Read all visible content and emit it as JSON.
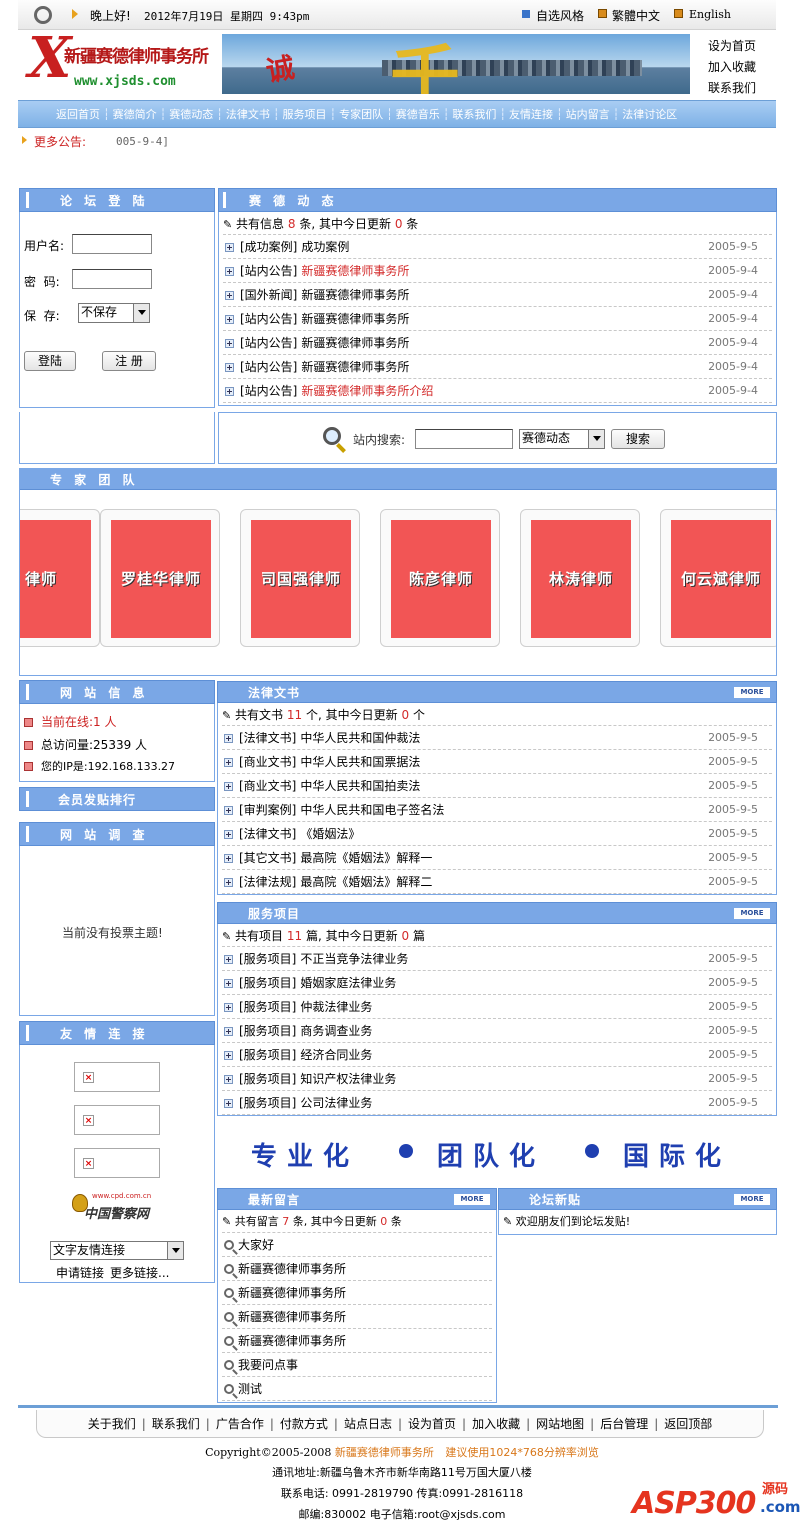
{
  "topbar": {
    "greeting": "晚上好!",
    "datetime": "2012年7月19日 星期四 9:43pm",
    "style_link": "自选风格",
    "trad_link": "繁體中文",
    "english_link": "English"
  },
  "header": {
    "logo_title": "新疆赛德律师事务所",
    "logo_letter": "X",
    "logo_url": "www.xjsds.com",
    "banner_text": "诚",
    "side_links": [
      "设为首页",
      "加入收藏",
      "联系我们"
    ]
  },
  "nav": {
    "items": [
      "返回首页",
      "赛德简介",
      "赛德动态",
      "法律文书",
      "服务项目",
      "专家团队",
      "赛德音乐",
      "联系我们",
      "友情连接",
      "站内留言",
      "法律讨论区"
    ]
  },
  "notice": {
    "label": "更多公告:",
    "text": "005-9-4]"
  },
  "login": {
    "title": "论 坛 登 陆",
    "username_label": "用户名:",
    "password_label": "密  码:",
    "save_label": "保  存:",
    "save_value": "不保存",
    "login_button": "登陆",
    "register_button": "注 册"
  },
  "news": {
    "title": "赛 德 动 态",
    "summary_pre": "共有信息",
    "summary_count": "8",
    "summary_mid": "条, 其中今日更新",
    "summary_today": "0",
    "summary_post": "条",
    "items": [
      {
        "cat": "[成功案例]",
        "title": "成功案例",
        "date": "2005-9-5",
        "highlight": false
      },
      {
        "cat": "[站内公告]",
        "title": "新疆赛德律师事务所",
        "date": "2005-9-4",
        "highlight": true
      },
      {
        "cat": "[国外新闻]",
        "title": "新疆赛德律师事务所",
        "date": "2005-9-4",
        "highlight": false
      },
      {
        "cat": "[站内公告]",
        "title": "新疆赛德律师事务所",
        "date": "2005-9-4",
        "highlight": false
      },
      {
        "cat": "[站内公告]",
        "title": "新疆赛德律师事务所",
        "date": "2005-9-4",
        "highlight": false
      },
      {
        "cat": "[站内公告]",
        "title": "新疆赛德律师事务所",
        "date": "2005-9-4",
        "highlight": false
      },
      {
        "cat": "[站内公告]",
        "title": "新疆赛德律师事务所介绍",
        "date": "2005-9-4",
        "highlight": true
      }
    ]
  },
  "search": {
    "label": "站内搜索:",
    "scope_value": "赛德动态",
    "button": "搜索"
  },
  "experts": {
    "title": "专 家 团 队",
    "lawyers": [
      "律师",
      "罗桂华律师",
      "司国强律师",
      "陈彦律师",
      "林涛律师",
      "何云斌律师"
    ]
  },
  "site_info": {
    "title": "网 站 信 息",
    "online": "当前在线:1 人",
    "visits": "总访问量:25339 人",
    "ip": "您的IP是:192.168.133.27"
  },
  "ranking": {
    "title": "会员发贴排行"
  },
  "survey": {
    "title": "网 站 调 查",
    "empty_text": "当前没有投票主题!"
  },
  "friends": {
    "title": "友 情 连 接",
    "police_logo_text": "中国警察网",
    "police_logo_url": "www.cpd.com.cn",
    "select_value": "文字友情连接",
    "apply_link": "申请链接",
    "more_link": "更多链接..."
  },
  "docs": {
    "title": "法律文书",
    "more": "MORE",
    "summary_pre": "共有文书",
    "summary_count": "11",
    "summary_mid": "个, 其中今日更新",
    "summary_today": "0",
    "summary_post": "个",
    "items": [
      {
        "cat": "[法律文书]",
        "title": "中华人民共和国仲裁法",
        "date": "2005-9-5"
      },
      {
        "cat": "[商业文书]",
        "title": "中华人民共和国票据法",
        "date": "2005-9-5"
      },
      {
        "cat": "[商业文书]",
        "title": "中华人民共和国拍卖法",
        "date": "2005-9-5"
      },
      {
        "cat": "[审判案例]",
        "title": "中华人民共和国电子签名法",
        "date": "2005-9-5"
      },
      {
        "cat": "[法律文书]",
        "title": "《婚姻法》",
        "date": "2005-9-5"
      },
      {
        "cat": "[其它文书]",
        "title": "最高院《婚姻法》解释一",
        "date": "2005-9-5"
      },
      {
        "cat": "[法律法规]",
        "title": "最高院《婚姻法》解释二",
        "date": "2005-9-5"
      }
    ]
  },
  "services": {
    "title": "服务项目",
    "more": "MORE",
    "summary_pre": "共有项目",
    "summary_count": "11",
    "summary_mid": "篇, 其中今日更新",
    "summary_today": "0",
    "summary_post": "篇",
    "items": [
      {
        "cat": "[服务项目]",
        "title": "不正当竞争法律业务",
        "date": "2005-9-5"
      },
      {
        "cat": "[服务项目]",
        "title": "婚姻家庭法律业务",
        "date": "2005-9-5"
      },
      {
        "cat": "[服务项目]",
        "title": "仲裁法律业务",
        "date": "2005-9-5"
      },
      {
        "cat": "[服务项目]",
        "title": "商务调查业务",
        "date": "2005-9-5"
      },
      {
        "cat": "[服务项目]",
        "title": "经济合同业务",
        "date": "2005-9-5"
      },
      {
        "cat": "[服务项目]",
        "title": "知识产权法律业务",
        "date": "2005-9-5"
      },
      {
        "cat": "[服务项目]",
        "title": "公司法律业务",
        "date": "2005-9-5"
      }
    ]
  },
  "slogan": {
    "parts": [
      "专业化",
      "团队化",
      "国际化"
    ]
  },
  "messages": {
    "title": "最新留言",
    "more": "MORE",
    "summary_pre": "共有留言",
    "summary_count": "7",
    "summary_mid": "条, 其中今日更新",
    "summary_today": "0",
    "summary_post": "条",
    "items": [
      "大家好",
      "新疆赛德律师事务所",
      "新疆赛德律师事务所",
      "新疆赛德律师事务所",
      "新疆赛德律师事务所",
      "我要问点事",
      "测试"
    ]
  },
  "forum": {
    "title": "论坛新贴",
    "more": "MORE",
    "welcome": "欢迎朋友们到论坛发贴!"
  },
  "footer": {
    "links": [
      "关于我们",
      "联系我们",
      "广告合作",
      "付款方式",
      "站点日志",
      "设为首页",
      "加入收藏",
      "网站地图",
      "后台管理",
      "返回顶部"
    ],
    "copyright_pre": "Copyright©2005-2008",
    "copyright_name": "新疆赛德律师事务所",
    "copyright_tip": "建议使用1024*768分辨率浏览",
    "address": "通讯地址:新疆乌鲁木齐市新华南路11号万国大厦八楼",
    "phone": "联系电话: 0991-2819790 传真:0991-2816118",
    "email": "邮编:830002 电子信箱:root@xjsds.com"
  },
  "watermark": {
    "brand": "ASP300",
    "suffix": "源码",
    "domain": ".com"
  }
}
